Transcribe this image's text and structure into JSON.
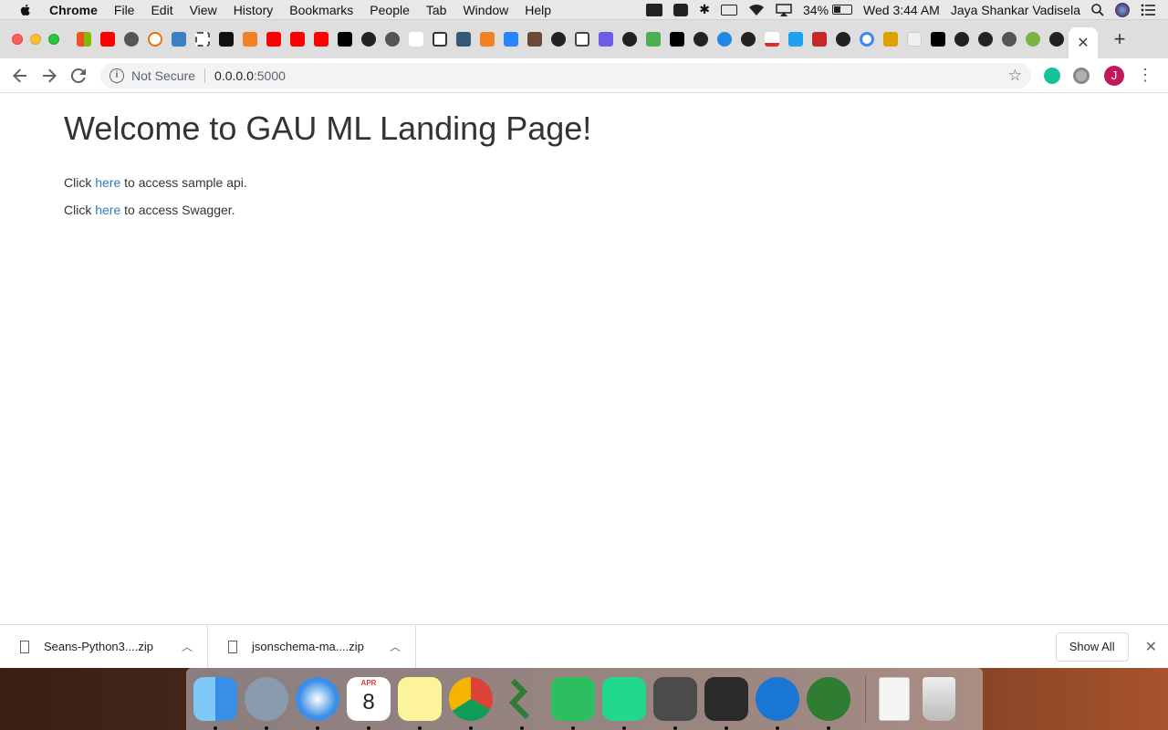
{
  "menubar": {
    "app_name": "Chrome",
    "items": [
      "File",
      "Edit",
      "View",
      "History",
      "Bookmarks",
      "People",
      "Tab",
      "Window",
      "Help"
    ],
    "battery_percent": "34%",
    "battery_level": 0.34,
    "clock": "Wed 3:44 AM",
    "user_name": "Jaya Shankar Vadisela"
  },
  "tabs": {
    "pinned_favicons": [
      "windows",
      "youtube",
      "globe",
      "squiggle",
      "dots",
      "grid",
      "hashbang",
      "orange-cube",
      "youtube",
      "youtube",
      "youtube",
      "dev",
      "github",
      "globe",
      "dollar",
      "trash",
      "tds",
      "orange-cube",
      "bitbucket",
      "portrait",
      "github",
      "book",
      "d-logo",
      "github",
      "bird",
      "jb",
      "github",
      "refresh",
      "github",
      "gmail",
      "infinity",
      "as",
      "github",
      "google",
      "figure",
      "cube",
      "medium",
      "github",
      "github",
      "globe",
      "green-circle",
      "github"
    ],
    "active_tab_close": "✕",
    "new_tab": "+"
  },
  "toolbar": {
    "not_secure_label": "Not Secure",
    "url_host": "0.0.0.0",
    "url_port": ":5000",
    "avatar_letter": "J"
  },
  "page": {
    "heading": "Welcome to GAU ML Landing Page!",
    "line1_prefix": "Click ",
    "line1_link": "here",
    "line1_suffix": " to access sample api.",
    "line2_prefix": "Click ",
    "line2_link": "here",
    "line2_suffix": " to access Swagger."
  },
  "downloads": {
    "items": [
      {
        "name": "Seans-Python3....zip"
      },
      {
        "name": "jsonschema-ma....zip"
      }
    ],
    "show_all_label": "Show All"
  },
  "dock": {
    "apps": [
      "finder",
      "launchpad",
      "safari",
      "calendar",
      "notes",
      "chrome",
      "sourcetree",
      "evernote",
      "pycharm",
      "sublime-text",
      "terminal",
      "maps-pin",
      "remote-desktop"
    ],
    "calendar_month": "APR",
    "calendar_day": "8",
    "extras": [
      "zip-archive",
      "trash"
    ]
  },
  "colors": {
    "link": "#337ab7",
    "heading": "#333333",
    "avatar": "#c2185b"
  }
}
